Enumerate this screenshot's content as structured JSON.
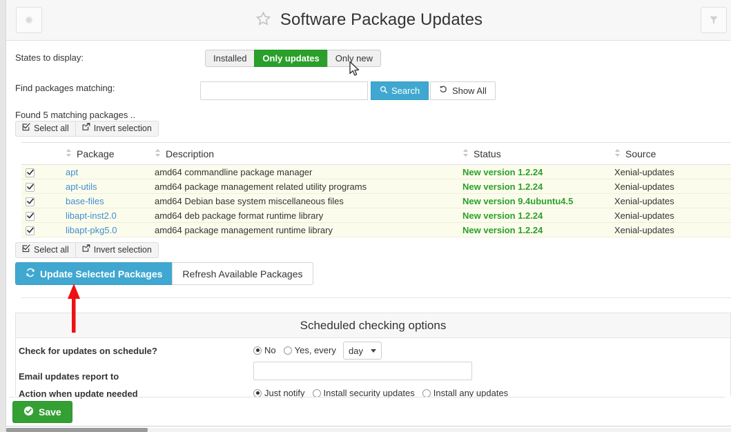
{
  "header": {
    "title": "Software Package Updates",
    "star_icon": "star-icon",
    "gear_icon": "gear-icon",
    "filter_icon": "filter-icon"
  },
  "filters": {
    "states_label": "States to display:",
    "state_buttons": [
      {
        "label": "Installed",
        "active": false
      },
      {
        "label": "Only updates",
        "active": true
      },
      {
        "label": "Only new",
        "active": false
      }
    ],
    "find_label": "Find packages matching:",
    "search_value": "",
    "search_placeholder": "",
    "search_button": "Search",
    "search_icon": "search-icon",
    "show_all_button": "Show All",
    "show_all_icon": "undo-icon"
  },
  "results": {
    "found_text": "Found 5 matching packages ..",
    "select_all_label": "Select all",
    "select_all_icon": "check-square-icon",
    "invert_label": "Invert selection",
    "invert_icon": "share-icon",
    "columns": [
      "Package",
      "Description",
      "Status",
      "Source"
    ],
    "rows": [
      {
        "checked": true,
        "package": "apt",
        "description": "amd64 commandline package manager",
        "status": "New version 1.2.24",
        "source": "Xenial-updates"
      },
      {
        "checked": true,
        "package": "apt-utils",
        "description": "amd64 package management related utility programs",
        "status": "New version 1.2.24",
        "source": "Xenial-updates"
      },
      {
        "checked": true,
        "package": "base-files",
        "description": "amd64 Debian base system miscellaneous files",
        "status": "New version 9.4ubuntu4.5",
        "source": "Xenial-updates"
      },
      {
        "checked": true,
        "package": "libapt-inst2.0",
        "description": "amd64 deb package format runtime library",
        "status": "New version 1.2.24",
        "source": "Xenial-updates"
      },
      {
        "checked": true,
        "package": "libapt-pkg5.0",
        "description": "amd64 package management runtime library",
        "status": "New version 1.2.24",
        "source": "Xenial-updates"
      }
    ]
  },
  "actions": {
    "update_label": "Update Selected Packages",
    "update_icon": "refresh-icon",
    "refresh_label": "Refresh Available Packages"
  },
  "schedule": {
    "panel_title": "Scheduled checking options",
    "check_label": "Check for updates on schedule?",
    "check_options": [
      {
        "label": "No",
        "selected": true
      },
      {
        "label": "Yes, every",
        "selected": false
      }
    ],
    "interval_value": "day",
    "email_label": "Email updates report to",
    "email_value": "",
    "action_label": "Action when update needed",
    "action_options": [
      {
        "label": "Just notify",
        "selected": true
      },
      {
        "label": "Install security updates",
        "selected": false
      },
      {
        "label": "Install any updates",
        "selected": false
      }
    ]
  },
  "footer": {
    "save_label": "Save",
    "save_icon": "check-circle-icon"
  },
  "colors": {
    "accent_green": "#2aa02a",
    "accent_blue": "#40a8d0",
    "status_green": "#2ba02b",
    "link_blue": "#3f8ed0",
    "row_yellow": "#fcfcec",
    "annotation_red": "#ee1111"
  }
}
